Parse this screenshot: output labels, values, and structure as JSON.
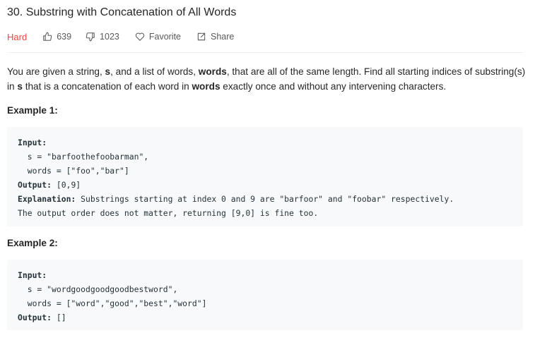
{
  "problem": {
    "title": "30. Substring with Concatenation of All Words",
    "difficulty": "Hard",
    "likes": "639",
    "dislikes": "1023",
    "favorite_label": "Favorite",
    "share_label": "Share"
  },
  "description": {
    "p1": "You are given a string, ",
    "s1": "s",
    "p2": ", and a list of words, ",
    "w1": "words",
    "p3": ", that are all of the same length. Find all starting indices of substring(s) in ",
    "s2": "s",
    "p4": " that is a concatenation of each word in ",
    "w2": "words",
    "p5": " exactly once and without any intervening characters."
  },
  "examples": [
    {
      "title": "Example 1:",
      "input_label": "Input:",
      "line_s": "  s = \"barfoothefoobarman\",",
      "line_words": "  words = [\"foo\",\"bar\"]",
      "output_label": "Output:",
      "output_value": " [0,9]",
      "explanation_label": "Explanation:",
      "explanation_value": " Substrings starting at index 0 and 9 are \"barfoor\" and \"foobar\" respectively.",
      "extra_line": "The output order does not matter, returning [9,0] is fine too."
    },
    {
      "title": "Example 2:",
      "input_label": "Input:",
      "line_s": "  s = \"wordgoodgoodgoodbestword\",",
      "line_words": "  words = [\"word\",\"good\",\"best\",\"word\"]",
      "output_label": "Output:",
      "output_value": " []"
    }
  ],
  "colors": {
    "difficulty_hard": "#ef4743",
    "code_background": "#f7f9fa",
    "meta_text": "#595959"
  },
  "icons": [
    "thumbs-up-icon",
    "thumbs-down-icon",
    "heart-icon",
    "share-icon"
  ]
}
